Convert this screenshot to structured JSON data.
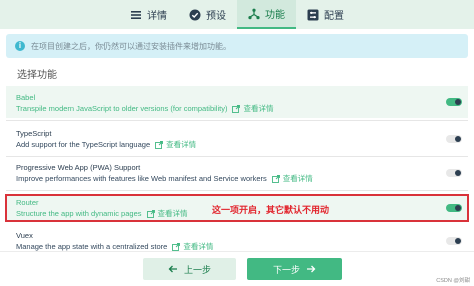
{
  "nav": {
    "tabs": [
      {
        "label": "详情",
        "icon": "list-icon",
        "active": false
      },
      {
        "label": "预设",
        "icon": "check-circle-icon",
        "active": false
      },
      {
        "label": "功能",
        "icon": "network-icon",
        "active": true
      },
      {
        "label": "配置",
        "icon": "settings-box-icon",
        "active": false
      }
    ]
  },
  "info": {
    "icon": "info-icon",
    "text": "在项目创建之后，你仍然可以通过安装插件来增加功能。"
  },
  "section_title": "选择功能",
  "more_label": "查看详情",
  "features": [
    {
      "name": "Babel",
      "desc": "Transpile modern JavaScript to older versions (for compatibility)",
      "enabled": true
    },
    {
      "name": "TypeScript",
      "desc": "Add support for the TypeScript language",
      "enabled": false
    },
    {
      "name": "Progressive Web App (PWA) Support",
      "desc": "Improve performances with features like Web manifest and Service workers",
      "enabled": false
    },
    {
      "name": "Router",
      "desc": "Structure the app with dynamic pages",
      "enabled": true
    },
    {
      "name": "Vuex",
      "desc": "Manage the app state with a centralized store",
      "enabled": false
    }
  ],
  "annotation": "这一项开启，其它默认不用动",
  "buttons": {
    "prev": "上一步",
    "next": "下一步"
  },
  "watermark": "CSDN @刘甜",
  "colors": {
    "accent": "#42b983",
    "highlight": "#d9323a",
    "nav_bg": "#e4f2ea",
    "info_bg": "#d5f0f7"
  }
}
